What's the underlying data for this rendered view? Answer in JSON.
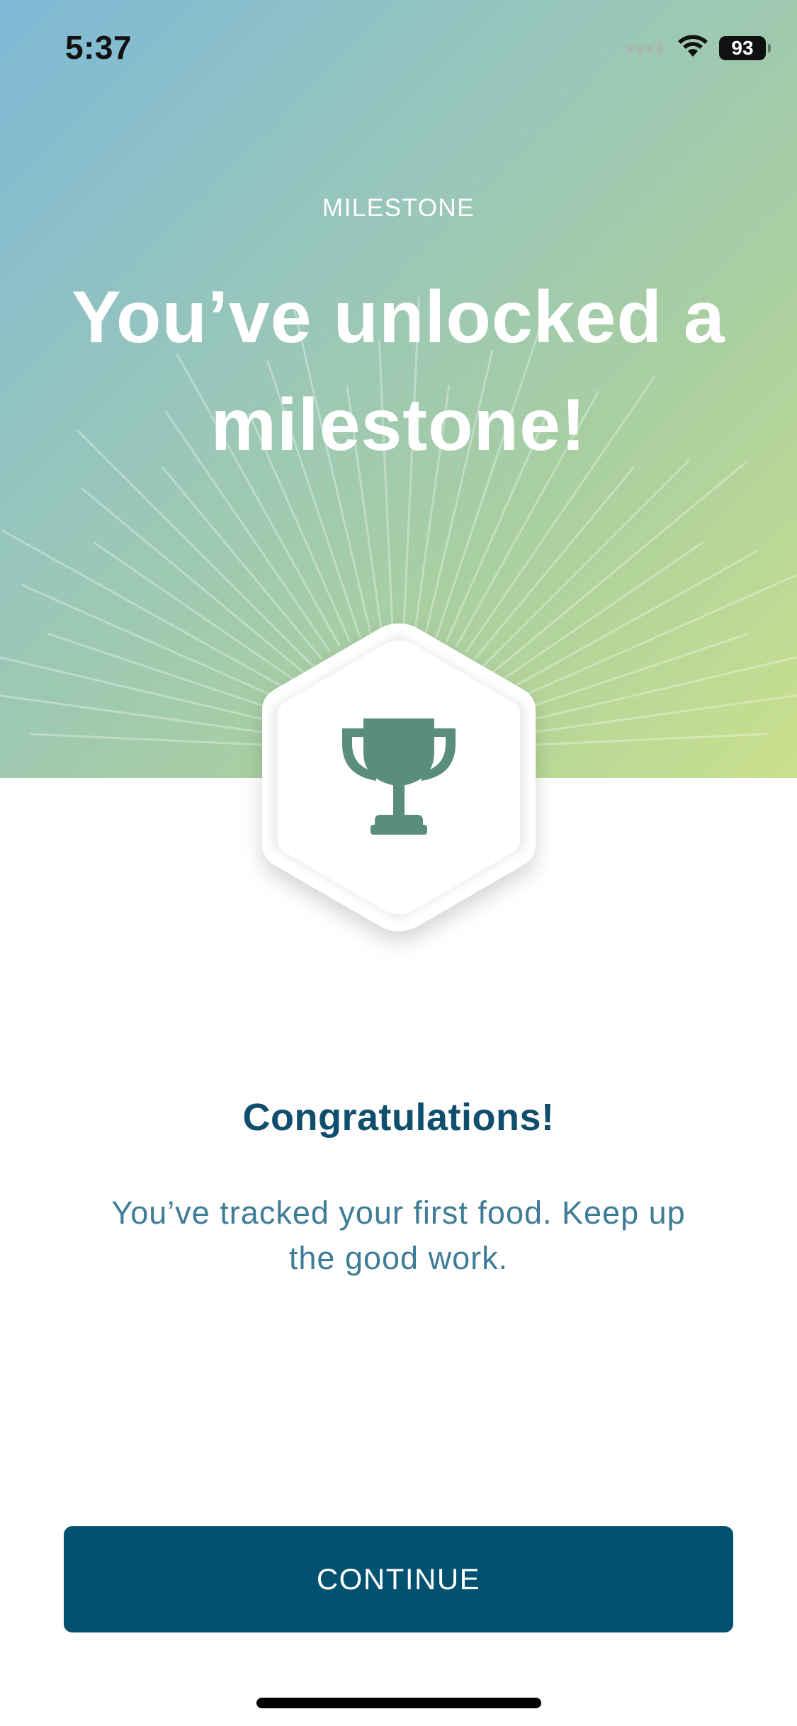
{
  "status_bar": {
    "time": "5:37",
    "battery": "93",
    "icons": [
      "signal-icon",
      "wifi-icon",
      "battery-icon"
    ]
  },
  "hero": {
    "eyebrow": "MILESTONE",
    "headline": "You’ve unlocked a milestone!",
    "gradient_colors": [
      "#7db8d6",
      "#94c4c1",
      "#a8cea2",
      "#c9e08c"
    ]
  },
  "badge": {
    "icon": "trophy-icon",
    "icon_color": "#5a8d7c"
  },
  "body": {
    "title": "Congratulations!",
    "message": "You’ve tracked your first food. Keep up the good work."
  },
  "actions": {
    "continue_label": "CONTINUE",
    "button_color": "#00506f"
  }
}
